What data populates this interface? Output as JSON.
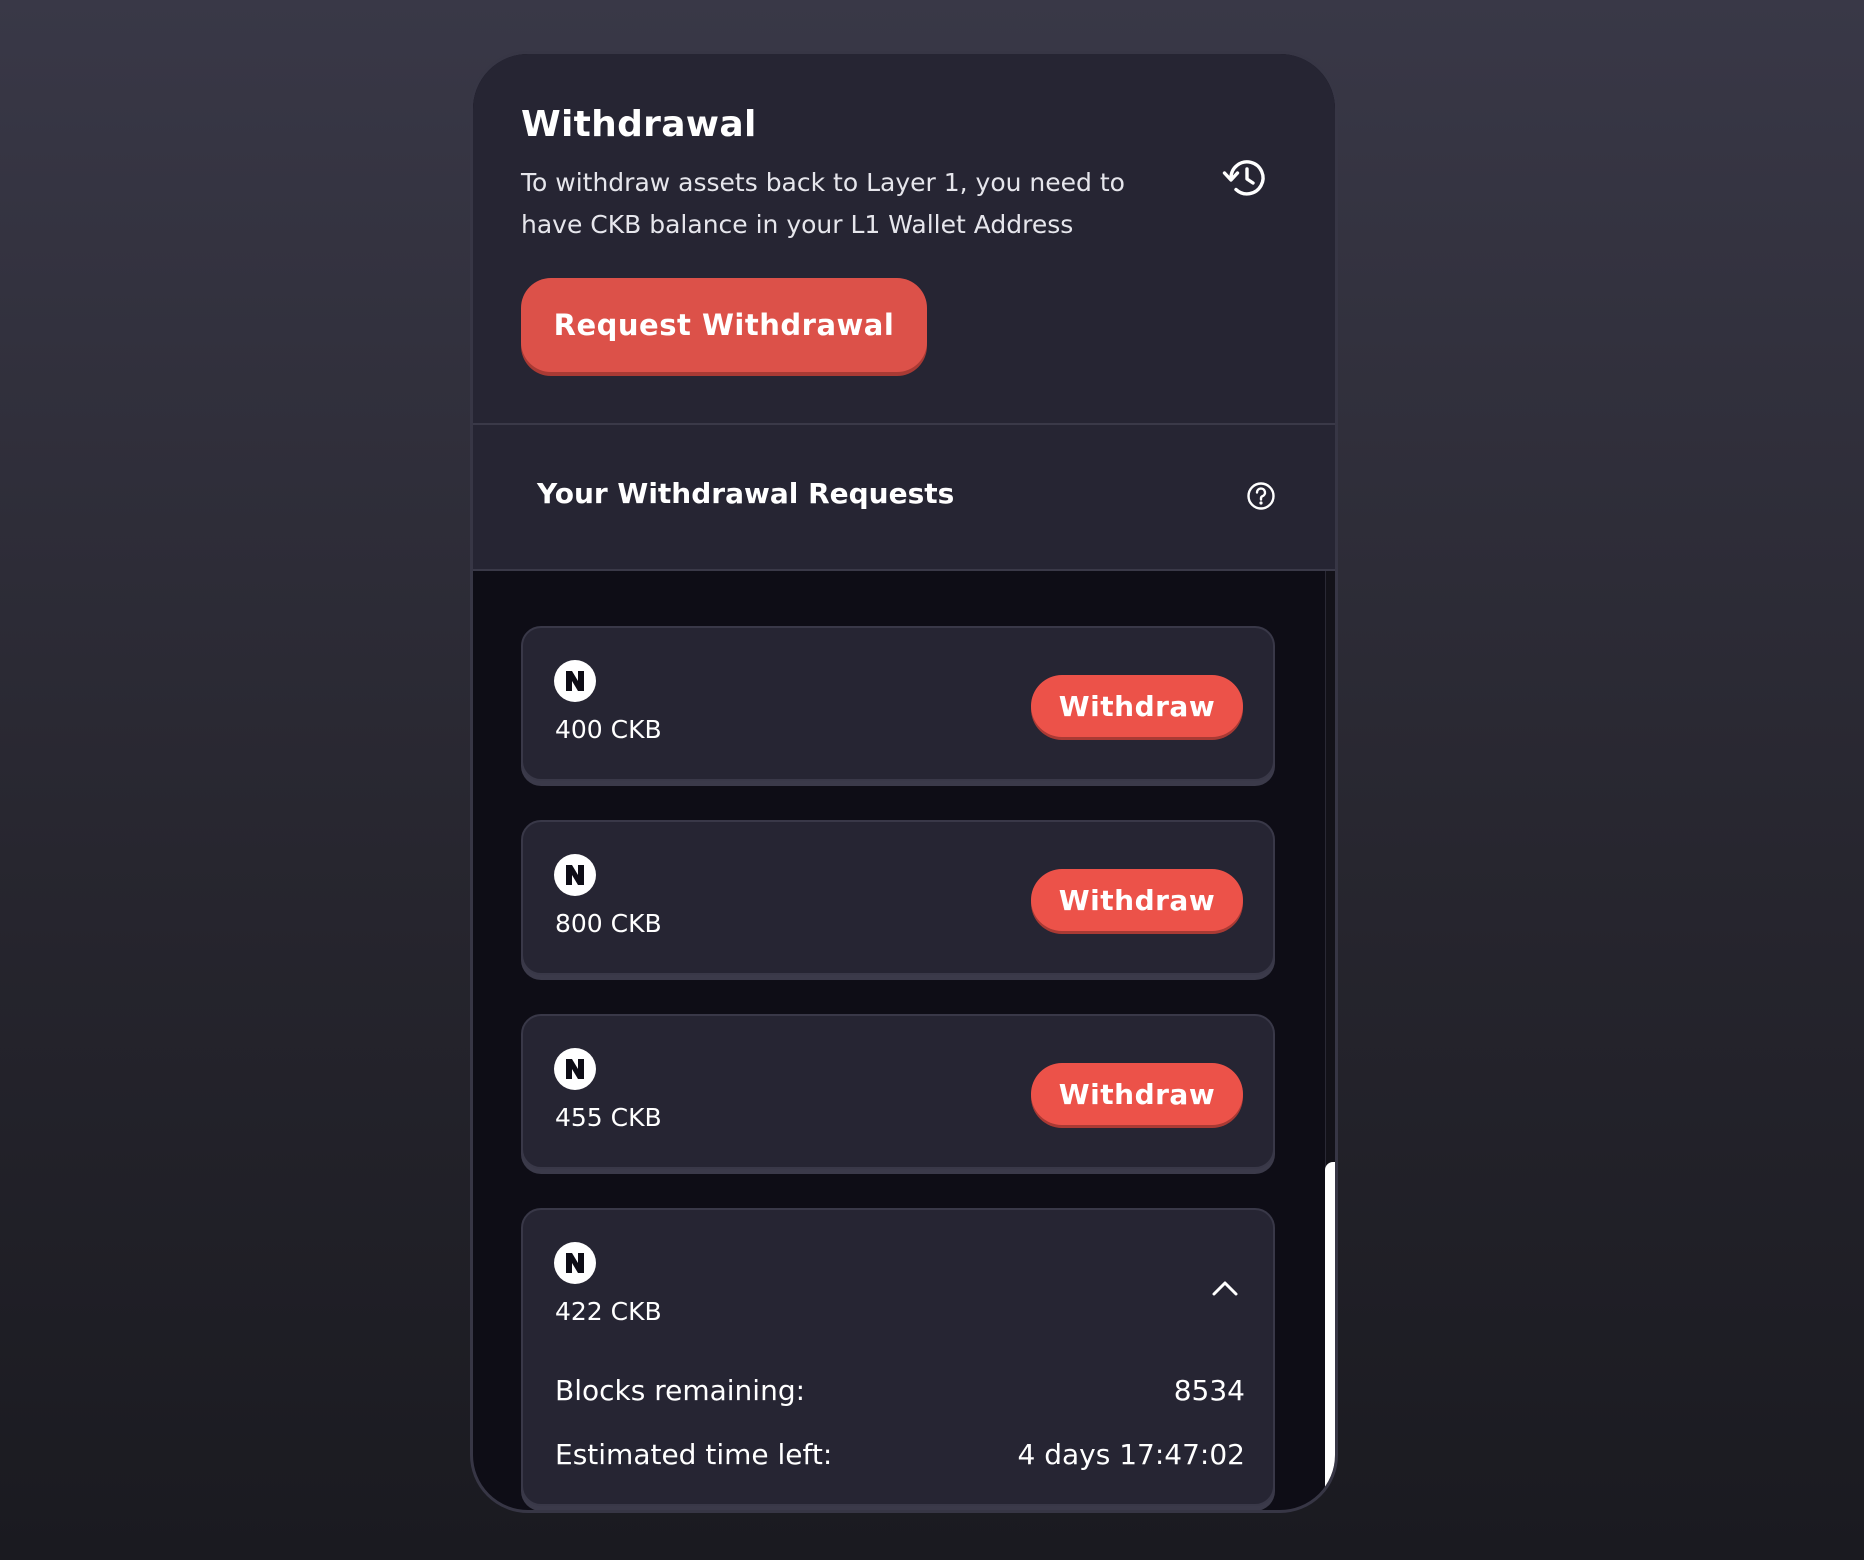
{
  "withdrawal": {
    "title": "Withdrawal",
    "description": "To withdraw assets back to Layer 1, you need to have CKB balance in your L1 Wallet Address",
    "request_button": "Request Withdrawal",
    "history_icon": "history-icon"
  },
  "requests": {
    "title": "Your Withdrawal Requests",
    "help_icon": "question-circle-icon",
    "items": [
      {
        "amount": "400 CKB",
        "action": "Withdraw",
        "icon": "ckb-token-icon"
      },
      {
        "amount": "800 CKB",
        "action": "Withdraw",
        "icon": "ckb-token-icon"
      },
      {
        "amount": "455 CKB",
        "action": "Withdraw",
        "icon": "ckb-token-icon"
      },
      {
        "amount": "422 CKB",
        "icon": "ckb-token-icon",
        "expanded": true,
        "blocks_label": "Blocks remaining:",
        "blocks_value": "8534",
        "time_label": "Estimated time left:",
        "time_value": "4 days 17:47:02"
      }
    ]
  },
  "colors": {
    "accent": "#ec5249",
    "card_bg": "#262533",
    "list_bg": "#0e0d16",
    "border": "#393848"
  }
}
